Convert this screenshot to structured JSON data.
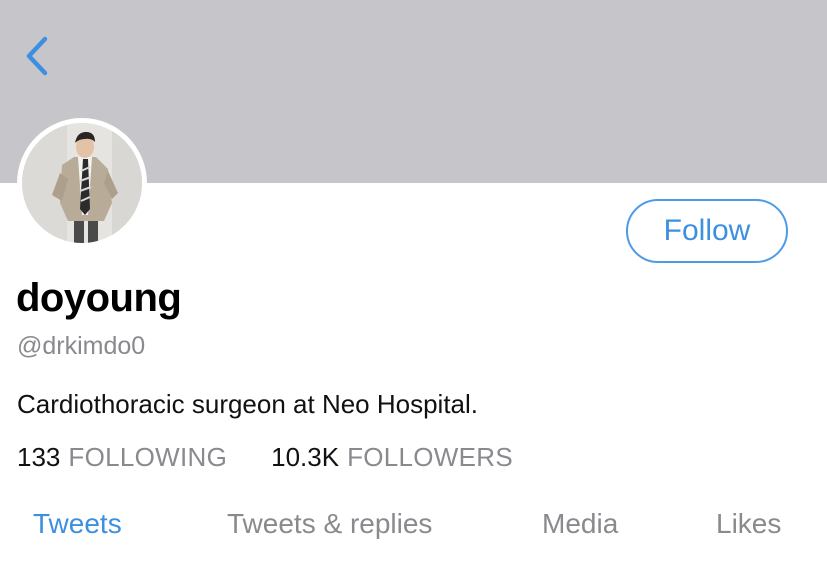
{
  "header": {
    "banner_color": "#c6c6ca",
    "back_icon": "chevron-left-icon",
    "accent_color": "#3d8fe0"
  },
  "profile": {
    "display_name": "doyoung",
    "handle": "@drkimdo0",
    "bio": "Cardiothoracic surgeon at Neo Hospital.",
    "follow_label": "Follow",
    "following_count": "133",
    "following_label": "FOLLOWING",
    "followers_count": "10.3K",
    "followers_label": "FOLLOWERS"
  },
  "tabs": [
    {
      "label": "Tweets",
      "active": true
    },
    {
      "label": "Tweets & replies",
      "active": false
    },
    {
      "label": "Media",
      "active": false
    },
    {
      "label": "Likes",
      "active": false
    }
  ]
}
